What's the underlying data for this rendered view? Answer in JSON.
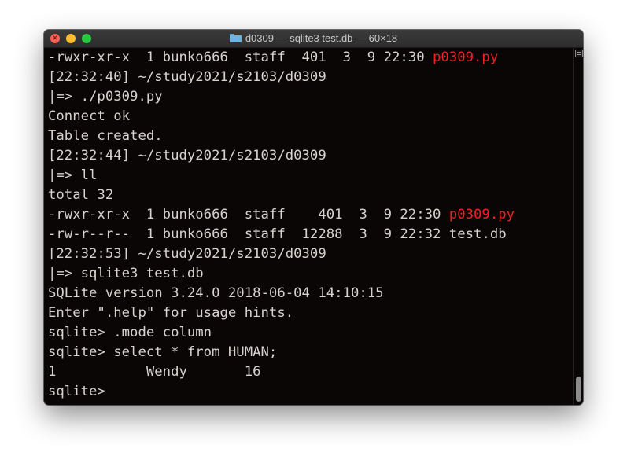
{
  "window": {
    "title": "d0309 — sqlite3 test.db — 60×18"
  },
  "terminal": {
    "lines": [
      {
        "segments": [
          {
            "text": "-rwxr-xr-x  1 bunko666  staff  401  3  9 22:30 "
          },
          {
            "text": "p0309.py",
            "color": "red"
          }
        ]
      },
      {
        "segments": [
          {
            "text": "[22:32:40] ~/study2021/s2103/d0309"
          }
        ]
      },
      {
        "segments": [
          {
            "text": "|=> ./p0309.py"
          }
        ]
      },
      {
        "segments": [
          {
            "text": "Connect ok"
          }
        ]
      },
      {
        "segments": [
          {
            "text": "Table created."
          }
        ]
      },
      {
        "segments": [
          {
            "text": "[22:32:44] ~/study2021/s2103/d0309"
          }
        ]
      },
      {
        "segments": [
          {
            "text": "|=> ll"
          }
        ]
      },
      {
        "segments": [
          {
            "text": "total 32"
          }
        ]
      },
      {
        "segments": [
          {
            "text": "-rwxr-xr-x  1 bunko666  staff    401  3  9 22:30 "
          },
          {
            "text": "p0309.py",
            "color": "red"
          }
        ]
      },
      {
        "segments": [
          {
            "text": "-rw-r--r--  1 bunko666  staff  12288  3  9 22:32 test.db"
          }
        ]
      },
      {
        "segments": [
          {
            "text": "[22:32:53] ~/study2021/s2103/d0309"
          }
        ]
      },
      {
        "segments": [
          {
            "text": "|=> sqlite3 test.db"
          }
        ]
      },
      {
        "segments": [
          {
            "text": "SQLite version 3.24.0 2018-06-04 14:10:15"
          }
        ]
      },
      {
        "segments": [
          {
            "text": "Enter \".help\" for usage hints."
          }
        ]
      },
      {
        "segments": [
          {
            "text": "sqlite> .mode column"
          }
        ]
      },
      {
        "segments": [
          {
            "text": "sqlite> select * from HUMAN;"
          }
        ]
      },
      {
        "segments": [
          {
            "text": "1           Wendy       16"
          }
        ]
      },
      {
        "segments": [
          {
            "text": "sqlite> "
          }
        ]
      }
    ]
  },
  "icons": {
    "close": "close-icon",
    "minimize": "minimize-icon",
    "zoom": "zoom-icon",
    "folder": "folder-icon",
    "scroll_toggle": "scroll-toggle-icon"
  },
  "colors": {
    "background": "#0b0606",
    "text": "#d6d2cf",
    "red": "#ef2020",
    "close": "#fe5f57",
    "minimize": "#febc2e",
    "zoom": "#28c840"
  }
}
